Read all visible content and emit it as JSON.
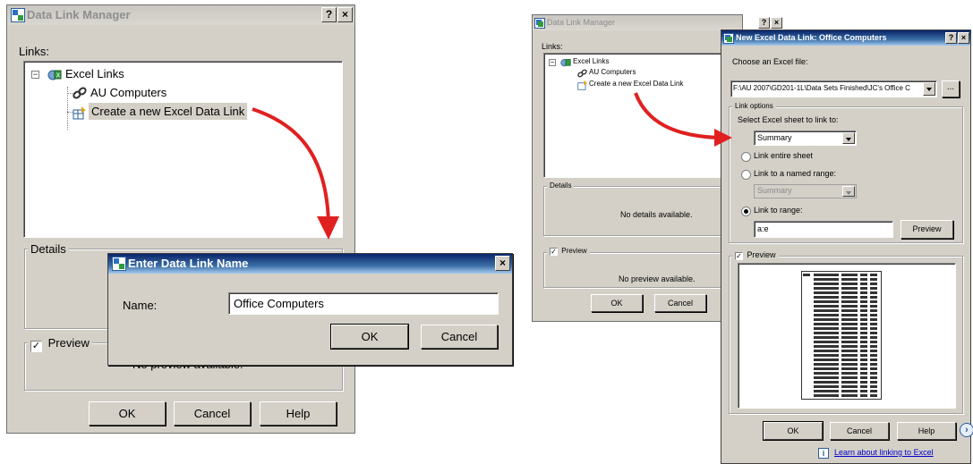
{
  "left_dialog": {
    "title": "Data Link Manager",
    "help_btn": "?",
    "close_btn": "×",
    "links_label": "Links:",
    "tree": {
      "root": "Excel Links",
      "items": [
        "AU Computers",
        "Create a new Excel Data Link"
      ]
    },
    "details_label": "Details",
    "preview_label": "Preview",
    "preview_checked": "✓",
    "no_preview_text": "No preview available.",
    "buttons": {
      "ok": "OK",
      "cancel": "Cancel",
      "help": "Help"
    }
  },
  "name_dialog": {
    "title": "Enter Data Link Name",
    "close_btn": "×",
    "name_label": "Name:",
    "name_value": "Office Computers",
    "buttons": {
      "ok": "OK",
      "cancel": "Cancel"
    }
  },
  "right_manager": {
    "title": "Data Link Manager",
    "help_btn": "?",
    "close_btn": "×",
    "links_label": "Links:",
    "tree": {
      "root": "Excel Links",
      "items": [
        "AU Computers",
        "Create a new Excel Data Link"
      ]
    },
    "details_label": "Details",
    "no_details_text": "No details available.",
    "preview_label": "Preview",
    "preview_checked": "✓",
    "no_preview_text": "No preview available.",
    "buttons": {
      "ok": "OK",
      "cancel": "Cancel"
    }
  },
  "new_link_dialog": {
    "title": "New Excel Data Link: Office Computers",
    "help_btn": "?",
    "close_btn": "×",
    "choose_file_label": "Choose an Excel file:",
    "file_path": "F:\\AU 2007\\GD201-1L\\Data Sets Finished\\JC's Office C",
    "browse_btn": "...",
    "link_options_label": "Link options",
    "select_sheet_label": "Select Excel sheet to link to:",
    "sheet_value": "Summary",
    "radio_entire_sheet": "Link entire sheet",
    "radio_named_range": "Link to a named range:",
    "named_range_value": "Summary",
    "radio_to_range": "Link to range:",
    "range_value": "a:e",
    "preview_btn": "Preview",
    "preview_label": "Preview",
    "preview_checked": "✓",
    "buttons": {
      "ok": "OK",
      "cancel": "Cancel",
      "help": "Help"
    },
    "learn_link": "Learn about linking to Excel",
    "info_icon_glyph": "i"
  },
  "colors": {
    "dialog_bg": "#d4d0c8",
    "active_title": "#0a246a",
    "arrow": "#e02020",
    "link": "#0000cc"
  }
}
